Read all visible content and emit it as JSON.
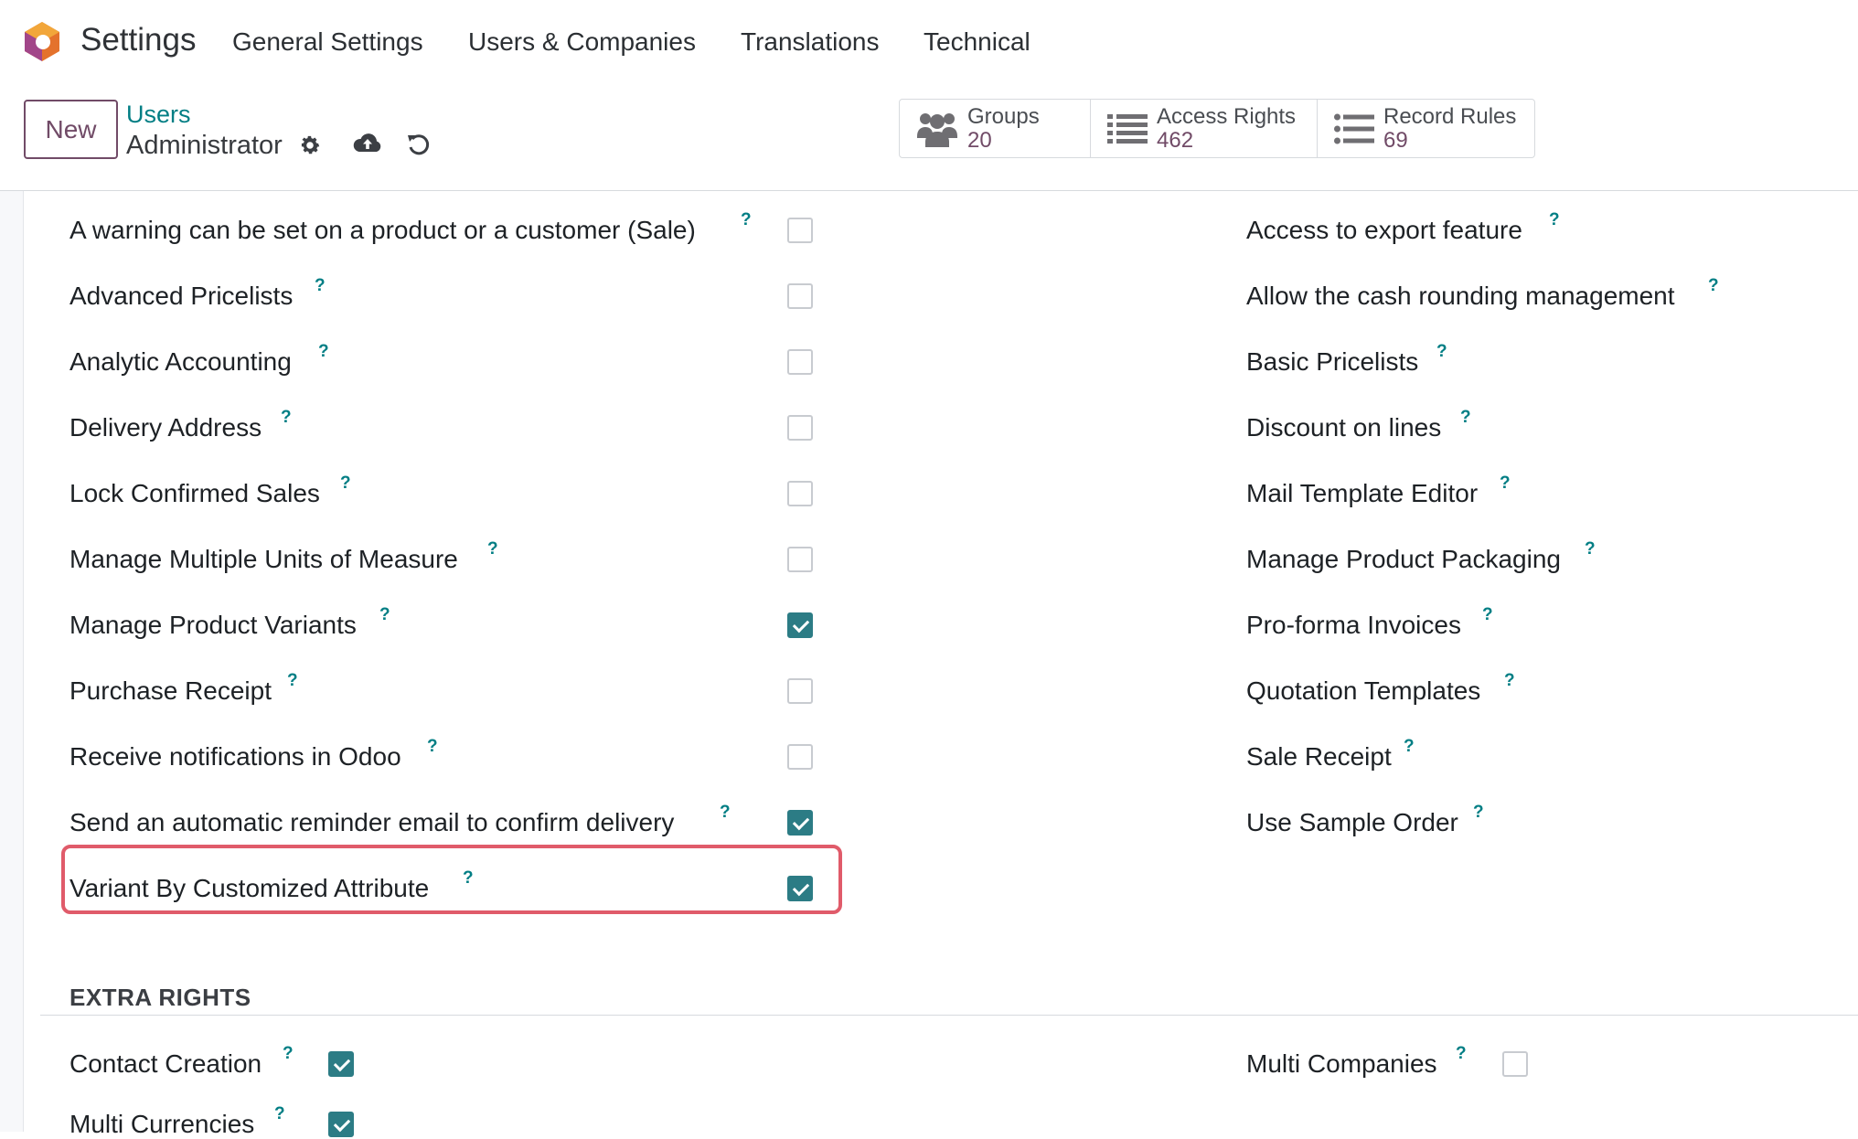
{
  "nav": {
    "app_title": "Settings",
    "menu": [
      "General Settings",
      "Users & Companies",
      "Translations",
      "Technical"
    ]
  },
  "control_panel": {
    "new_label": "New",
    "breadcrumb_parent": "Users",
    "breadcrumb_current": "Administrator",
    "smart_buttons": [
      {
        "label": "Groups",
        "count": "20",
        "icon": "users-icon"
      },
      {
        "label": "Access Rights",
        "count": "462",
        "icon": "list-icon"
      },
      {
        "label": "Record Rules",
        "count": "69",
        "icon": "list-icon"
      }
    ]
  },
  "technical_rights": {
    "left": [
      {
        "label": "A warning can be set on a product or a customer (Sale)",
        "checked": false
      },
      {
        "label": "Advanced Pricelists",
        "checked": false
      },
      {
        "label": "Analytic Accounting",
        "checked": false
      },
      {
        "label": "Delivery Address",
        "checked": false
      },
      {
        "label": "Lock Confirmed Sales",
        "checked": false
      },
      {
        "label": "Manage Multiple Units of Measure",
        "checked": false
      },
      {
        "label": "Manage Product Variants",
        "checked": true
      },
      {
        "label": "Purchase Receipt",
        "checked": false
      },
      {
        "label": "Receive notifications in Odoo",
        "checked": false
      },
      {
        "label": "Send an automatic reminder email to confirm delivery",
        "checked": true
      },
      {
        "label": "Variant By Customized Attribute",
        "checked": true
      }
    ],
    "right": [
      {
        "label": "Access to export feature"
      },
      {
        "label": "Allow the cash rounding management"
      },
      {
        "label": "Basic Pricelists"
      },
      {
        "label": "Discount on lines"
      },
      {
        "label": "Mail Template Editor"
      },
      {
        "label": "Manage Product Packaging"
      },
      {
        "label": "Pro-forma Invoices"
      },
      {
        "label": "Quotation Templates"
      },
      {
        "label": "Sale Receipt"
      },
      {
        "label": "Use Sample Order"
      }
    ]
  },
  "help_marker": "?",
  "extra_rights": {
    "title": "EXTRA RIGHTS",
    "left": [
      {
        "label": "Contact Creation",
        "checked": true
      },
      {
        "label": "Multi Currencies",
        "checked": true
      }
    ],
    "right": [
      {
        "label": "Multi Companies",
        "checked": false
      }
    ]
  },
  "colors": {
    "brand": "#714b67",
    "accent": "#017e84",
    "checked": "#2c7c85",
    "highlight": "#e05b6a"
  }
}
